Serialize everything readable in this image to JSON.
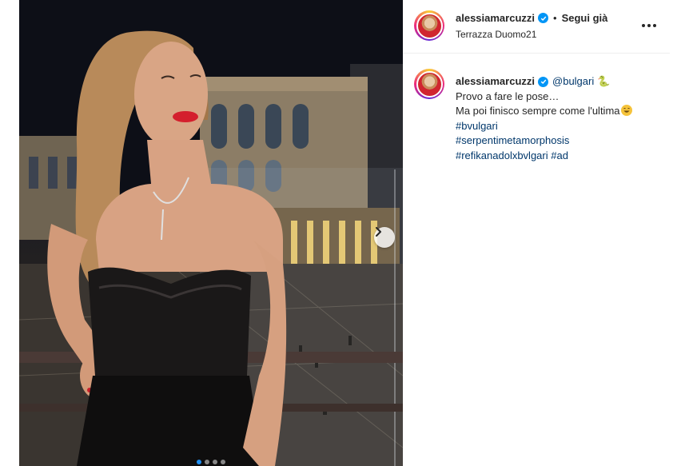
{
  "post": {
    "username": "alessiamarcuzzi",
    "separator": "•",
    "follow_label": "Segui già",
    "location": "Terrazza Duomo21",
    "more_icon": "more-horizontal-icon"
  },
  "caption": {
    "username": "alessiamarcuzzi",
    "mention": "@bulgari",
    "snake_emoji": "🐍",
    "line1": "Provo a fare le pose…",
    "line2": "Ma poi finisco sempre come l'ultima",
    "hashtags": [
      "#bvulgari",
      "#serpentimetamorphosis",
      "#refikanadolxbvlgari",
      "#ad"
    ]
  },
  "carousel": {
    "total_slides": 4,
    "active_index": 0,
    "next_icon": "chevron-right-icon"
  },
  "colors": {
    "link": "#00376b",
    "verified": "#0095f6",
    "active_dot": "#1f8ef1"
  }
}
